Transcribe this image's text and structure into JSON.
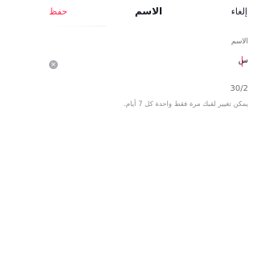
{
  "header": {
    "cancel_label": "إلغاء",
    "title": "الاسم",
    "save_label": "حفظ"
  },
  "name_field": {
    "label": "الاسم",
    "value": "س",
    "clear_icon": "clear-circle-icon"
  },
  "counter": "30/2",
  "hint": "يمكن تغيير لقبك مرة فقط واحدة كل 7 أيام.",
  "colors": {
    "accent": "#fe2c55",
    "text": "#161823",
    "muted": "#8a8b91"
  }
}
